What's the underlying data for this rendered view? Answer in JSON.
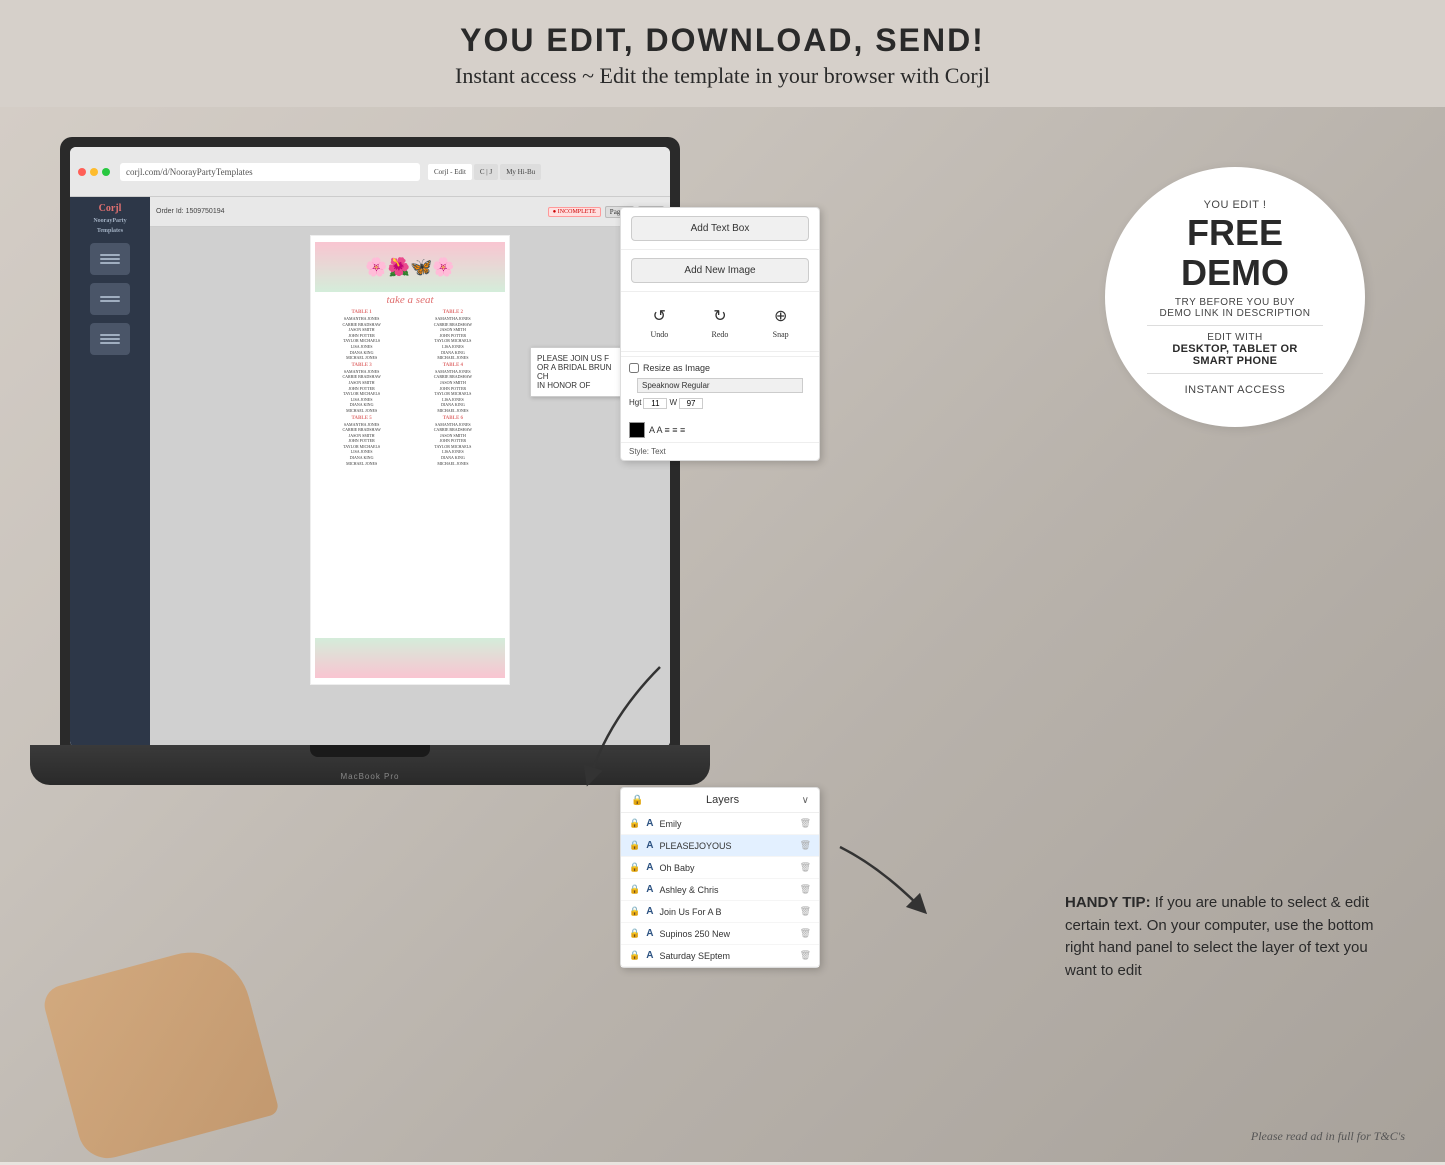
{
  "banner": {
    "main_title": "YOU EDIT, DOWNLOAD, SEND!",
    "sub_title": "Instant access ~ Edit the template in your browser with Corjl"
  },
  "free_demo_circle": {
    "you_edit": "YOU EDIT !",
    "free": "FREE",
    "demo": "DEMO",
    "try_before": "TRY BEFORE YOU BUY",
    "demo_link": "DEMO LINK IN DESCRIPTION",
    "edit_with": "EDIT WITH",
    "devices": "DESKTOP, TABLET OR",
    "smart_phone": "SMART PHONE",
    "instant": "INSTANT ACCESS"
  },
  "corjl_panel": {
    "add_text_box": "Add Text Box",
    "add_new_image": "Add New Image",
    "undo": "Undo",
    "redo": "Redo",
    "snap": "Snap",
    "style_text": "Style: Text",
    "resize_as_image": "Resize as Image",
    "font_label": "Speaknow Regular"
  },
  "layers_panel": {
    "title": "Layers",
    "chevron": "∨",
    "items": [
      {
        "lock": "🔒",
        "type": "A",
        "name": "Emily",
        "selected": false
      },
      {
        "lock": "🔒",
        "type": "A",
        "name": "PLEASEJOYOUS",
        "selected": true
      },
      {
        "lock": "🔒",
        "type": "A",
        "name": "Oh Baby",
        "selected": false
      },
      {
        "lock": "🔒",
        "type": "A",
        "name": "Ashley & Chris",
        "selected": false
      },
      {
        "lock": "🔒",
        "type": "A",
        "name": "Join Us For A B",
        "selected": false
      },
      {
        "lock": "🔒",
        "type": "A",
        "name": "Supinos 250 New",
        "selected": false
      },
      {
        "lock": "🔒",
        "type": "A",
        "name": "Saturday SEptem",
        "selected": false
      }
    ]
  },
  "handy_tip": {
    "bold_text": "HANDY TIP:",
    "text": " If you are unable to select & edit certain text. On your computer, use the bottom right hand panel to select the layer of text you want to edit"
  },
  "browser": {
    "url": "corjl.com/d/NoorayPartyTemplates",
    "tab1": "Corjl - Edit",
    "tab2": "C | J",
    "tab3": "My Hi-Bu"
  },
  "seating_chart": {
    "title": "take a seat",
    "floral_emoji": "🌸🌺🦋"
  },
  "footer": {
    "text": "Please read ad in full for T&C's"
  }
}
